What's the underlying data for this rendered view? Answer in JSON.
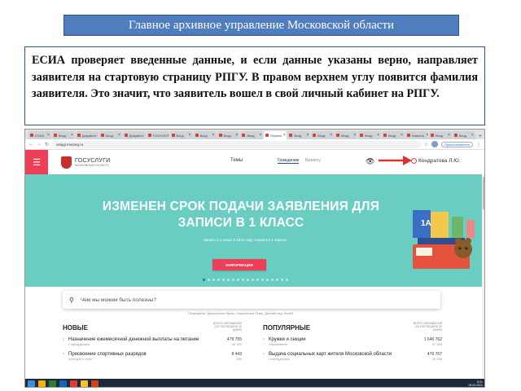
{
  "slide": {
    "header": "Главное архивное управление Московской области",
    "body_text": "ЕСИА проверяет введенные данные, и если данные указаны верно, направляет заявителя на стартовую страницу РПГУ. В правом верхнем углу появится фамилия заявителя. Это значит, что заявитель вошел в свой личный кабинет на РПГУ."
  },
  "browser": {
    "tabs": [
      "ЕСИА",
      "Вход",
      "Документ",
      "Вход",
      "Документ",
      "ГОСУСЛУГИ",
      "Вход",
      "Вход",
      "Вход",
      "Вход",
      "Портал",
      "Вход",
      "Вход",
      "Вход",
      "Вход",
      "Вход",
      "Новость",
      "Вход",
      "Вход"
    ],
    "active_tab_index": 10,
    "url": "uslugi.mosreg.ru",
    "sync_label": "Приостановлено"
  },
  "site": {
    "logo_title": "ГОСУСЛУГИ",
    "logo_subtitle": "МОСКОВСКАЯ ОБЛАСТЬ",
    "themes_label": "Темы",
    "roles": [
      "Гражданам",
      "Бизнесу"
    ],
    "user_name": "Кондратова Л.Ю.",
    "accent_color": "#ee3f58",
    "banner_color": "#69cdc2"
  },
  "banner": {
    "title": "ИЗМЕНЕН СРОК ПОДАЧИ ЗАЯВЛЕНИЯ ДЛЯ ЗАПИСИ В 1 КЛАСС",
    "subtitle": "Запись в 1 класс в 2021 году откроется 1 апреля",
    "button_label": "ИНФОРМАЦИЯ",
    "slides_total": 18,
    "slide_active": 1
  },
  "search": {
    "placeholder": "Чем мы можем быть полезны?"
  },
  "popular_line": "Популярное: Дошкольное бронь, Социальные Темы, Детский сад, Лицей",
  "new_services": {
    "title": "НОВЫЕ",
    "stat_label": "ВСЕГО ОБРАЩЕНИЙ (ЗА ПОСЛЕДНИЕ 30 ДНЕЙ)",
    "items": [
      {
        "title": "Назначение ежемесячной денежной выплаты на питание",
        "dept": "Соцподдержка",
        "total": "479 755",
        "recent": "28 160"
      },
      {
        "title": "Присвоение спортивных разрядов",
        "dept": "Культура и спорт",
        "total": "8 443",
        "recent": "558"
      }
    ]
  },
  "popular_services": {
    "title": "ПОПУЛЯРНЫЕ",
    "stat_label": "ВСЕГО ОБРАЩЕНИЙ (ЗА ПОСЛЕДНИЕ 30 ДНЕЙ)",
    "items": [
      {
        "title": "Кружки и секции",
        "dept": "Образование",
        "total": "1 646 762",
        "recent": "97 283"
      },
      {
        "title": "Выдача социальных карт жителя Московской области",
        "dept": "Соцподдержка",
        "total": "476 767",
        "recent": "40 338"
      }
    ]
  },
  "taskbar": {
    "time": "8:21",
    "date": "09.02.2021"
  }
}
